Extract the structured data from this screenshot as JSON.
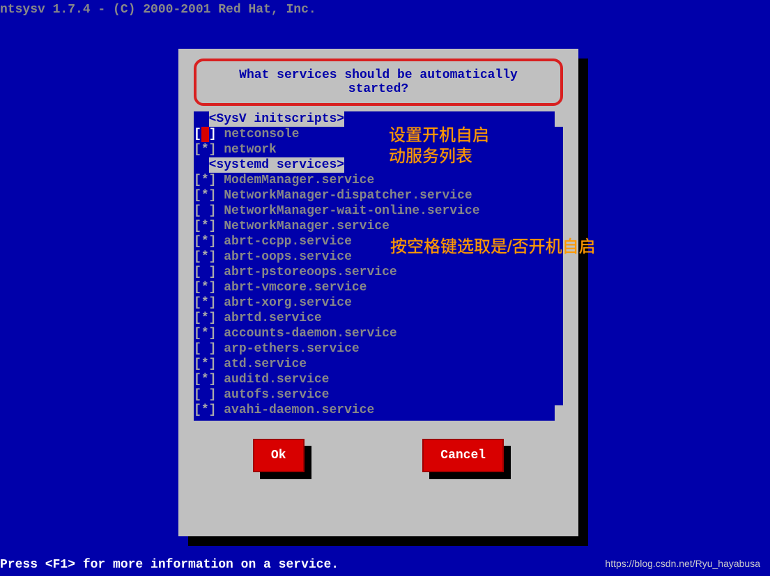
{
  "header": "ntsysv 1.7.4 - (C) 2000-2001 Red Hat, Inc.",
  "footer": "Press <F1> for more information on a service.",
  "watermark": "https://blog.csdn.net/Ryu_hayabusa",
  "dialog": {
    "prompt": "What services should be automatically started?",
    "ok_label": "Ok",
    "cancel_label": "Cancel"
  },
  "groups": [
    {
      "label": "<SysV initscripts>"
    },
    {
      "label": "<systemd services>"
    }
  ],
  "services": [
    {
      "group": 0,
      "enabled": false,
      "name": "netconsole",
      "cursor": true
    },
    {
      "group": 0,
      "enabled": true,
      "name": "network"
    },
    {
      "group": 1,
      "enabled": true,
      "name": "ModemManager.service"
    },
    {
      "group": 1,
      "enabled": true,
      "name": "NetworkManager-dispatcher.service"
    },
    {
      "group": 1,
      "enabled": false,
      "name": "NetworkManager-wait-online.service"
    },
    {
      "group": 1,
      "enabled": true,
      "name": "NetworkManager.service"
    },
    {
      "group": 1,
      "enabled": true,
      "name": "abrt-ccpp.service"
    },
    {
      "group": 1,
      "enabled": true,
      "name": "abrt-oops.service"
    },
    {
      "group": 1,
      "enabled": false,
      "name": "abrt-pstoreoops.service"
    },
    {
      "group": 1,
      "enabled": true,
      "name": "abrt-vmcore.service"
    },
    {
      "group": 1,
      "enabled": true,
      "name": "abrt-xorg.service"
    },
    {
      "group": 1,
      "enabled": true,
      "name": "abrtd.service"
    },
    {
      "group": 1,
      "enabled": true,
      "name": "accounts-daemon.service"
    },
    {
      "group": 1,
      "enabled": false,
      "name": "arp-ethers.service"
    },
    {
      "group": 1,
      "enabled": true,
      "name": "atd.service"
    },
    {
      "group": 1,
      "enabled": true,
      "name": "auditd.service"
    },
    {
      "group": 1,
      "enabled": false,
      "name": "autofs.service"
    },
    {
      "group": 1,
      "enabled": true,
      "name": "avahi-daemon.service"
    }
  ],
  "annotations": {
    "line1": "设置开机自启",
    "line2": "动服务列表",
    "line3": "按空格键选取是/否开机自启"
  }
}
